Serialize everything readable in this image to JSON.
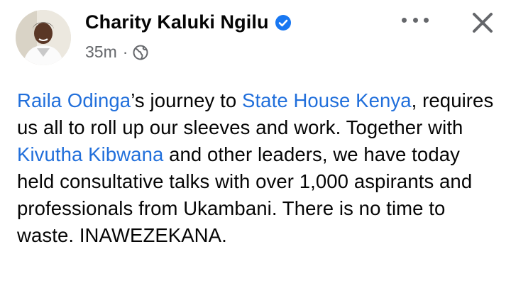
{
  "post": {
    "author": "Charity Kaluki Ngilu",
    "timestamp": "35m",
    "separator": "·",
    "visibility_icon": "globe-icon",
    "verified_icon": "verified-badge-icon",
    "more_icon": "more-options-icon",
    "close_icon": "close-icon",
    "accent_color": "#216fdb",
    "text": {
      "mention_1": "Raila Odinga",
      "seg_1": "’s journey to ",
      "mention_2": "State House Kenya",
      "seg_2": ", requires us all to roll up our sleeves and work. Together with ",
      "mention_3": "Kivutha Kibwana",
      "seg_3": " and other leaders, we have today held consultative talks with over 1,000 aspirants and professionals from Ukambani. There is no time to waste. INAWEZEKANA."
    }
  }
}
